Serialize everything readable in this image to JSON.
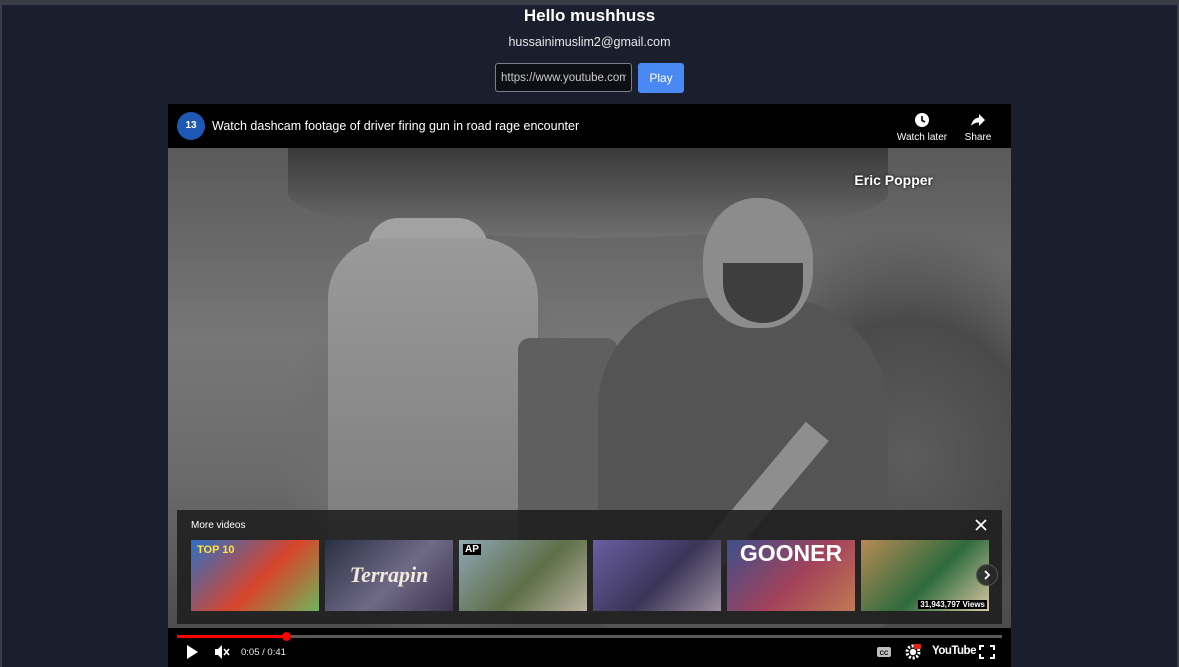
{
  "page": {
    "greeting": "Hello mushhuss",
    "email": "hussainimuslim2@gmail.com"
  },
  "url_form": {
    "placeholder": "https://www.youtube.com",
    "play_label": "Play"
  },
  "player": {
    "channel_logo_text": "13",
    "title": "Watch dashcam footage of driver firing gun in road rage encounter",
    "watch_later_label": "Watch later",
    "share_label": "Share",
    "video_overlay_text": "Eric Popper",
    "more_videos": {
      "title": "More videos",
      "thumbnails": [
        {
          "name": "shark-cartoon",
          "caption": "TOP 10",
          "colors": [
            "#2c6fc5",
            "#d8452b",
            "#6fb35b"
          ]
        },
        {
          "name": "terrapin",
          "caption": "Terrapin",
          "colors": [
            "#2a2f45",
            "#6f6a86",
            "#3d3551"
          ]
        },
        {
          "name": "ap-news",
          "caption": "AP",
          "colors": [
            "#8fa6b6",
            "#5e6f48",
            "#b9b2a0"
          ]
        },
        {
          "name": "kitchen-scene",
          "caption": "",
          "colors": [
            "#6a5ea3",
            "#3b3558",
            "#9c8f9e"
          ]
        },
        {
          "name": "gooner",
          "caption": "GOONER",
          "colors": [
            "#3d4f8c",
            "#a3425a",
            "#c07a54"
          ]
        },
        {
          "name": "basketball",
          "caption": "31,943,797 Views",
          "colors": [
            "#b58a55",
            "#2f6b3e",
            "#d9c7a2"
          ]
        }
      ]
    },
    "progress_fraction": 0.132,
    "time_current": "0:05",
    "time_total": "0:41",
    "time_display": "0:05 / 0:41",
    "youtube_label": "YouTube",
    "icons": [
      "play-icon",
      "mute-icon",
      "captions-icon",
      "settings-icon",
      "fullscreen-icon",
      "watch-later-icon",
      "share-icon",
      "close-icon",
      "chevron-right-icon"
    ],
    "colors": {
      "accent_blue": "#4a89f3",
      "progress_red": "#ff0000",
      "page_bg": "#1b1f2d"
    }
  }
}
